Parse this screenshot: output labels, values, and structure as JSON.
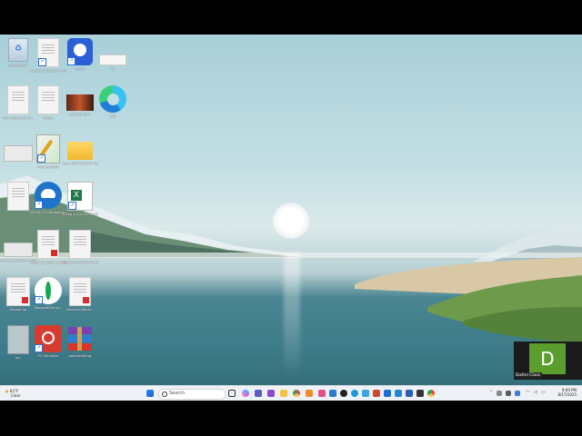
{
  "desktop": {
    "icons": [
      {
        "label": "Recycle Bin"
      },
      {
        "label": "Scratch: Discover or Chirp Nodes + Kid..."
      },
      {
        "label": "Bravo"
      },
      {
        "label": "ok"
      },
      {
        "label": "Tiny prj/Reference..."
      },
      {
        "label": "Airbus"
      },
      {
        "label": "Jurassic.mp4"
      },
      {
        "label": "edy"
      },
      {
        "label": ""
      },
      {
        "label": "Paint.gradient"
      },
      {
        "label": "Class Cont 2025-07 Google Gem - Bkk"
      },
      {
        "label": ""
      },
      {
        "label": "MySQL 8.0 Workbench"
      },
      {
        "label": "Zhang 4-4 2025-07 Google Sheet"
      },
      {
        "label": "Screenshot 2025-07-21 134402"
      },
      {
        "label": "Check_In_Delta 2a Delta"
      },
      {
        "label": "Screenshot 2025-07-21 135043"
      },
      {
        "label": "Receipt for"
      },
      {
        "label": "MongoDBComp..."
      },
      {
        "label": "Services_Matrix..."
      },
      {
        "label": "Acc"
      },
      {
        "label": "PC Optimizer"
      },
      {
        "label": "gdrivesettings"
      }
    ]
  },
  "overlay": {
    "tile_letter": "D",
    "tooltip": "Duttel Class"
  },
  "taskbar": {
    "weather_temp": "63°F",
    "weather_cond": "Clear",
    "search_placeholder": "Search",
    "clock_time": "9:00 PM",
    "clock_date": "8/17/2025"
  }
}
